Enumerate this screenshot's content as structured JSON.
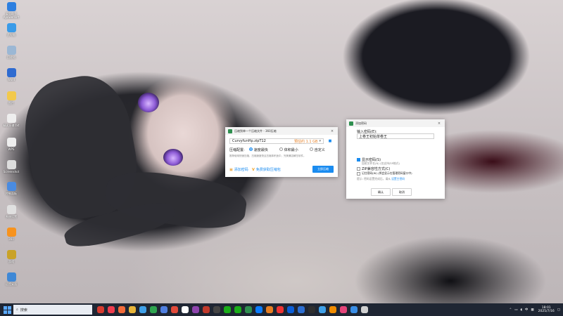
{
  "desktop_icons": [
    {
      "label": "爱思助手 Apowersoft",
      "color": "#2d7fe0"
    },
    {
      "label": "此电脑",
      "color": "#3a9be8"
    },
    {
      "label": "回收站",
      "color": "#9bb7d4"
    },
    {
      "label": "Word",
      "color": "#2f6bd0"
    },
    {
      "label": "图片",
      "color": "#f2c94c"
    },
    {
      "label": "精灵乐谱.txt",
      "color": "#eeeeee"
    },
    {
      "label": "WPS",
      "color": "#eeeeee"
    },
    {
      "label": "Screenshot",
      "color": "#dddddd"
    },
    {
      "label": "控制面板",
      "color": "#4a8be0"
    },
    {
      "label": "系统设置",
      "color": "#e0e0e0"
    },
    {
      "label": "360",
      "color": "#f7931e"
    },
    {
      "label": "游戏",
      "color": "#c9a227"
    },
    {
      "label": "远程桌面",
      "color": "#3f88d6"
    }
  ],
  "compress_window": {
    "title": "压缩到单一个压缩文件 - 360压缩",
    "filename": "CurvyfunHp.zipT12",
    "size_note": "预估约 1.1 GB",
    "level_label": "压缩配置:",
    "options": [
      "速度最快",
      "体积最小",
      "自定义"
    ],
    "hint": "推荐使用快速压缩，压缩速度快且压缩体积适中，完美兼容解压软件。",
    "add_password": "添加密码",
    "vip_offer": "免费获取压缩包",
    "start_button": "立即压缩"
  },
  "password_dialog": {
    "title": "添加密码",
    "input_label": "输入密码(E):",
    "password_value": "上卷王初始单卷王",
    "show_password": "显示密码(S)",
    "note1": "加密文件名(N) (仅支持ZIP格式)",
    "zip_compat": "ZIP兼容性方式(C)",
    "save_pw": "记住密码(W) (将会显示在管理密码窗口中)",
    "manage_note": "提示: 密码设置完成后，请从",
    "manage_link": "设置主密码",
    "ok": "确认",
    "cancel": "取消"
  },
  "taskbar": {
    "search_placeholder": "搜索",
    "apps": [
      "#d63b2f",
      "#ee3d4e",
      "#f26b3a",
      "#e8b53a",
      "#3fa0e8",
      "#2ea44f",
      "#4f7fe0",
      "#e14a3a",
      "#ffffff",
      "#8e44ad",
      "#c0392b",
      "#444444",
      "#1aad19",
      "#1aad19",
      "#2f8f4f",
      "#0a7cff",
      "#e67e22",
      "#e33",
      "#0b5ed7",
      "#2d6fd2",
      "#2f2f2f",
      "#3fa0e8",
      "#f08c00",
      "#e5457a",
      "#3a8ee6",
      "#d0d0d0"
    ],
    "ime": "中",
    "time": "18:01",
    "date": "2025/7/16"
  }
}
